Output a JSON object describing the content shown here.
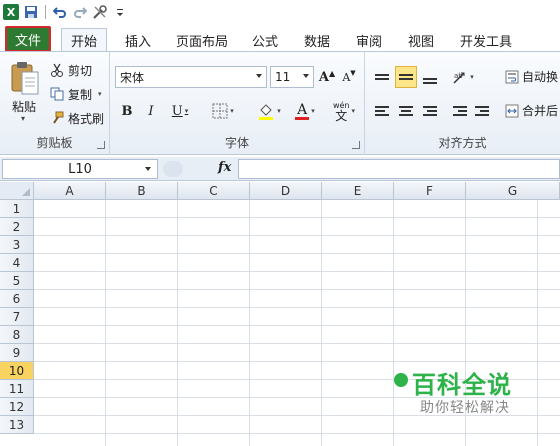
{
  "qat": {
    "app_icon": "X",
    "icons": [
      "excel-app-icon",
      "save-icon",
      "undo-icon",
      "redo-icon",
      "tools-icon",
      "customize-icon"
    ]
  },
  "tabs": {
    "file": "文件",
    "home": "开始",
    "insert": "插入",
    "page_layout": "页面布局",
    "formulas": "公式",
    "data": "数据",
    "review": "审阅",
    "view": "视图",
    "developer": "开发工具"
  },
  "clipboard": {
    "paste": "粘贴",
    "cut": "剪切",
    "copy": "复制",
    "format_painter": "格式刷",
    "group_label": "剪贴板"
  },
  "font": {
    "name": "宋体",
    "size": "11",
    "bold": "B",
    "italic": "I",
    "underline": "U",
    "font_color_letter": "A",
    "wen_label": "wén",
    "wen_char": "文",
    "grow": "A",
    "shrink": "A",
    "group_label": "字体",
    "highlight_color": "#ffff00",
    "font_color": "#e02020"
  },
  "alignment": {
    "wrap_text": "自动换",
    "merge_center": "合并后",
    "group_label": "对齐方式"
  },
  "formula_bar": {
    "name_box": "L10",
    "fx": "fx",
    "content": ""
  },
  "grid": {
    "columns": [
      "A",
      "B",
      "C",
      "D",
      "E",
      "F",
      "G"
    ],
    "rows": [
      "1",
      "2",
      "3",
      "4",
      "5",
      "6",
      "7",
      "8",
      "9",
      "10",
      "11",
      "12",
      "13"
    ],
    "active_row": "10"
  },
  "watermark": {
    "title": "百科全说",
    "subtitle": "助你轻松解决",
    "color": "#2eb24a"
  }
}
